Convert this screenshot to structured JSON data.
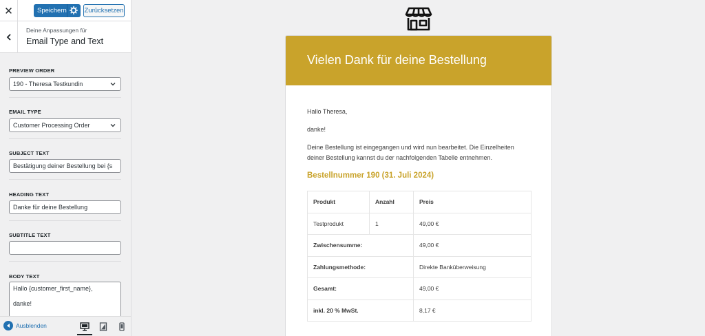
{
  "topbar": {
    "close_label": "✕",
    "save_label": "Speichern",
    "reset_label": "Zurücksetzen"
  },
  "section": {
    "subtitle": "Deine Anpassungen für",
    "title": "Email Type and Text"
  },
  "fields": {
    "preview_order": {
      "label": "PREVIEW ORDER",
      "value": "190 - Theresa Testkundin"
    },
    "email_type": {
      "label": "EMAIL TYPE",
      "value": "Customer Processing Order"
    },
    "subject_text": {
      "label": "SUBJECT TEXT",
      "value": "Bestätigung deiner Bestellung bei {s"
    },
    "heading_text": {
      "label": "HEADING TEXT",
      "value": "Danke für deine Bestellung"
    },
    "subtitle_text": {
      "label": "SUBTITLE TEXT",
      "value": ""
    },
    "body_text": {
      "label": "BODY TEXT",
      "line1": "Hallo {customer_first_name},",
      "line2": "danke!"
    }
  },
  "footer": {
    "collapse_label": "Ausblenden",
    "devices": [
      "desktop-icon",
      "tablet-icon",
      "mobile-icon"
    ],
    "active_device": "desktop"
  },
  "email": {
    "heading": "Vielen Dank für deine Bestellung",
    "greeting": "Hallo Theresa,",
    "thanks": "danke!",
    "body_line1": "Deine Bestellung ist eingegangen und wird nun bearbeitet. Die Einzelheiten",
    "body_line2": "deiner Bestellung kannst du der nachfolgenden Tabelle entnehmen.",
    "order_title": "Bestellnummer 190 (31. Juli 2024)",
    "table": {
      "headers": [
        "Produkt",
        "Anzahl",
        "Preis"
      ],
      "item": {
        "product": "Testprodukt",
        "qty": "1",
        "price": "49,00 €"
      },
      "totals": [
        {
          "label": "Zwischensumme:",
          "value": "49,00 €"
        },
        {
          "label": "Zahlungsmethode:",
          "value": "Direkte Banküberweisung"
        },
        {
          "label": "Gesamt:",
          "value": "49,00 €"
        },
        {
          "label": "inkl. 20 % MwSt.",
          "value": "8,17 €"
        }
      ]
    }
  },
  "colors": {
    "accent": "#c9a32b",
    "primary_button": "#2271b1"
  }
}
